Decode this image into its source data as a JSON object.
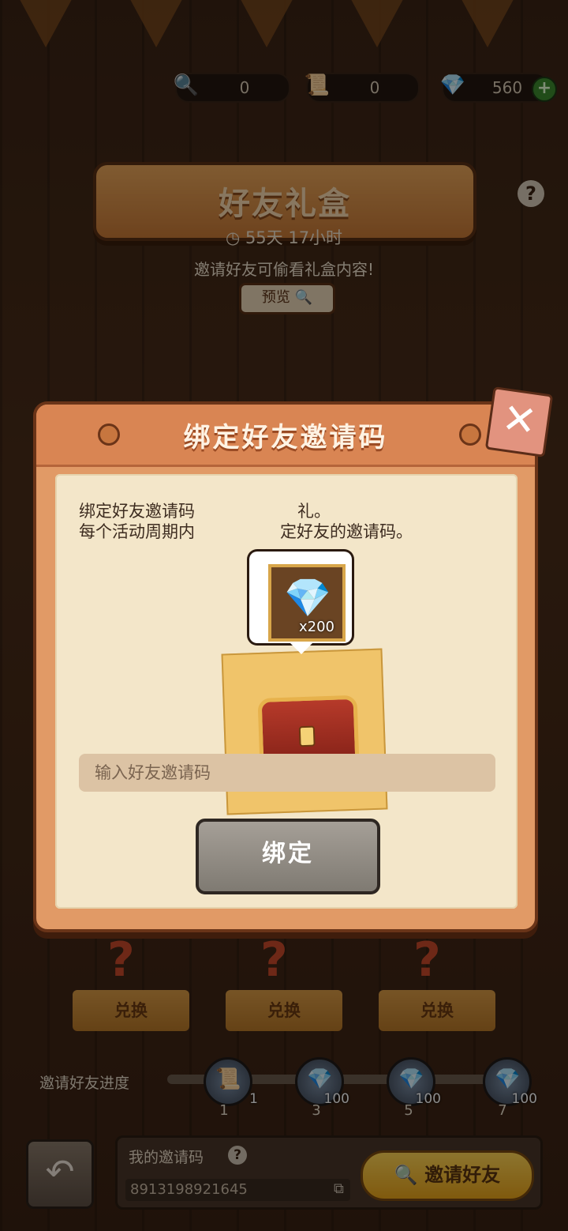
{
  "currencies": [
    {
      "icon": "magnifier-icon",
      "value": "0"
    },
    {
      "icon": "scroll-icon",
      "value": "0"
    },
    {
      "icon": "diamond-icon",
      "value": "560"
    }
  ],
  "page": {
    "title": "好友礼盒",
    "timer": "55天 17小时",
    "hint": "邀请好友可偷看礼盒内容!",
    "preview_label": "预览",
    "help": "?"
  },
  "modal": {
    "title": "绑定好友邀请码",
    "desc_line1": "绑定好友邀请码",
    "desc_line1_end": "礼。",
    "desc_line2": "每个活动周期内",
    "desc_line2_end": "定好友的邀请码。",
    "reward_count": "x200",
    "input_placeholder": "输入好友邀请码",
    "bind_label": "绑定",
    "close_label": "✕"
  },
  "shop": {
    "exchange_label": "兑换"
  },
  "progress": {
    "label": "邀请好友进度",
    "nodes": [
      {
        "amount": "1",
        "step": "1"
      },
      {
        "amount": "100",
        "step": "3"
      },
      {
        "amount": "100",
        "step": "5"
      },
      {
        "amount": "100",
        "step": "7"
      }
    ]
  },
  "footer": {
    "my_code_label": "我的邀请码",
    "my_code": "8913198921645",
    "invite_label": "邀请好友"
  }
}
